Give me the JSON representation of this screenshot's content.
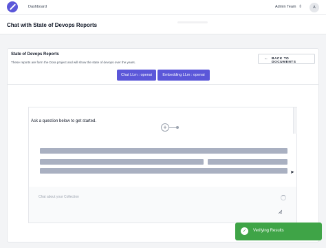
{
  "topbar": {
    "nav_dashboard": "Dashboard",
    "team_name": "Admin Team",
    "team_chevron_icon": "chevron-updown-icon",
    "avatar_initial": "A"
  },
  "page": {
    "title": "Chat with State of Devops Reports"
  },
  "collection": {
    "title": "State of Devops Reports",
    "description": "These reports are form the Dora project and will show the state of devops over the years.",
    "back_button_label": "BACK TO DOCUMENTS",
    "chat_llm_label": "Chat LLm : openai",
    "embedding_llm_label": "Embedding LLm : openai"
  },
  "chat": {
    "prompt": "Ask a question below to get started.",
    "input_placeholder": "Chat about your Collection",
    "input_value": ""
  },
  "toast": {
    "message": "Verifying Results"
  },
  "colors": {
    "accent": "#5b57d9",
    "success": "#3fa447",
    "skeleton": "#a9b0c1"
  }
}
